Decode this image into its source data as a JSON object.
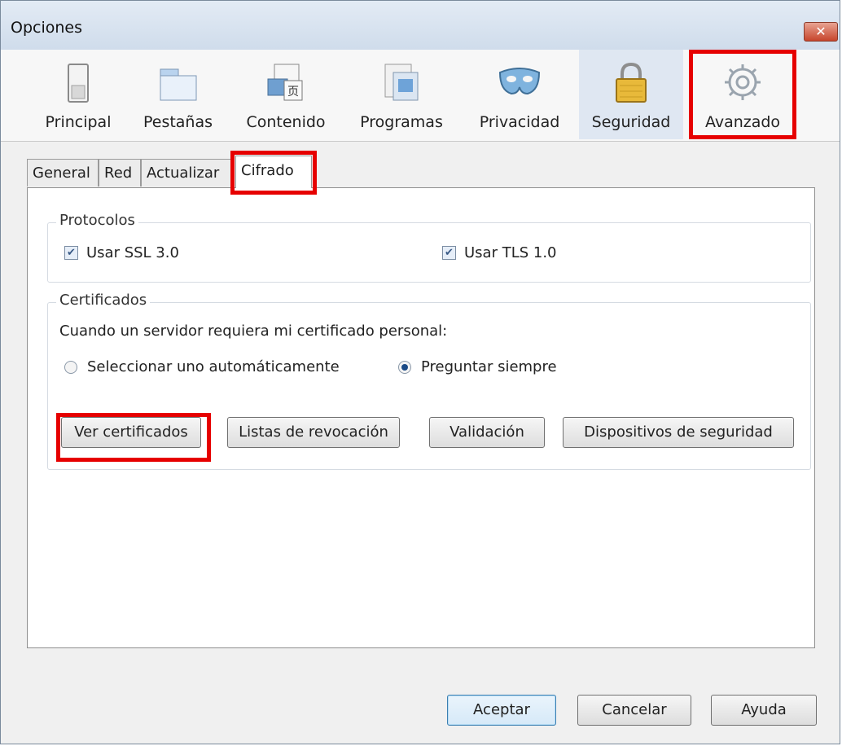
{
  "window": {
    "title": "Opciones",
    "close_glyph": "✕"
  },
  "toolbar": {
    "items": [
      {
        "label": "Principal",
        "icon": "switch-icon"
      },
      {
        "label": "Pestañas",
        "icon": "tabs-icon"
      },
      {
        "label": "Contenido",
        "icon": "content-icon"
      },
      {
        "label": "Programas",
        "icon": "programs-icon"
      },
      {
        "label": "Privacidad",
        "icon": "mask-icon"
      },
      {
        "label": "Seguridad",
        "icon": "lock-icon"
      },
      {
        "label": "Avanzado",
        "icon": "gear-icon"
      }
    ],
    "selected": "Avanzado"
  },
  "subtabs": {
    "items": [
      "General",
      "Red",
      "Actualizar",
      "Cifrado"
    ],
    "active": "Cifrado"
  },
  "protocols": {
    "legend": "Protocolos",
    "ssl_label": "Usar SSL 3.0",
    "tls_label": "Usar TLS 1.0",
    "ssl_checked": true,
    "tls_checked": true,
    "check_glyph": "✔"
  },
  "certificates": {
    "legend": "Certificados",
    "prompt": "Cuando un servidor requiera mi certificado personal:",
    "radio_auto": "Seleccionar uno automáticamente",
    "radio_ask": "Preguntar siempre",
    "selected_radio": "Preguntar siempre",
    "buttons": {
      "view": "Ver certificados",
      "revocation": "Listas de revocación",
      "validation": "Validación",
      "devices": "Dispositivos de seguridad"
    }
  },
  "footer": {
    "accept": "Aceptar",
    "cancel": "Cancelar",
    "help": "Ayuda"
  },
  "colors": {
    "highlight": "#e60000",
    "accent": "#3c7fb1"
  }
}
